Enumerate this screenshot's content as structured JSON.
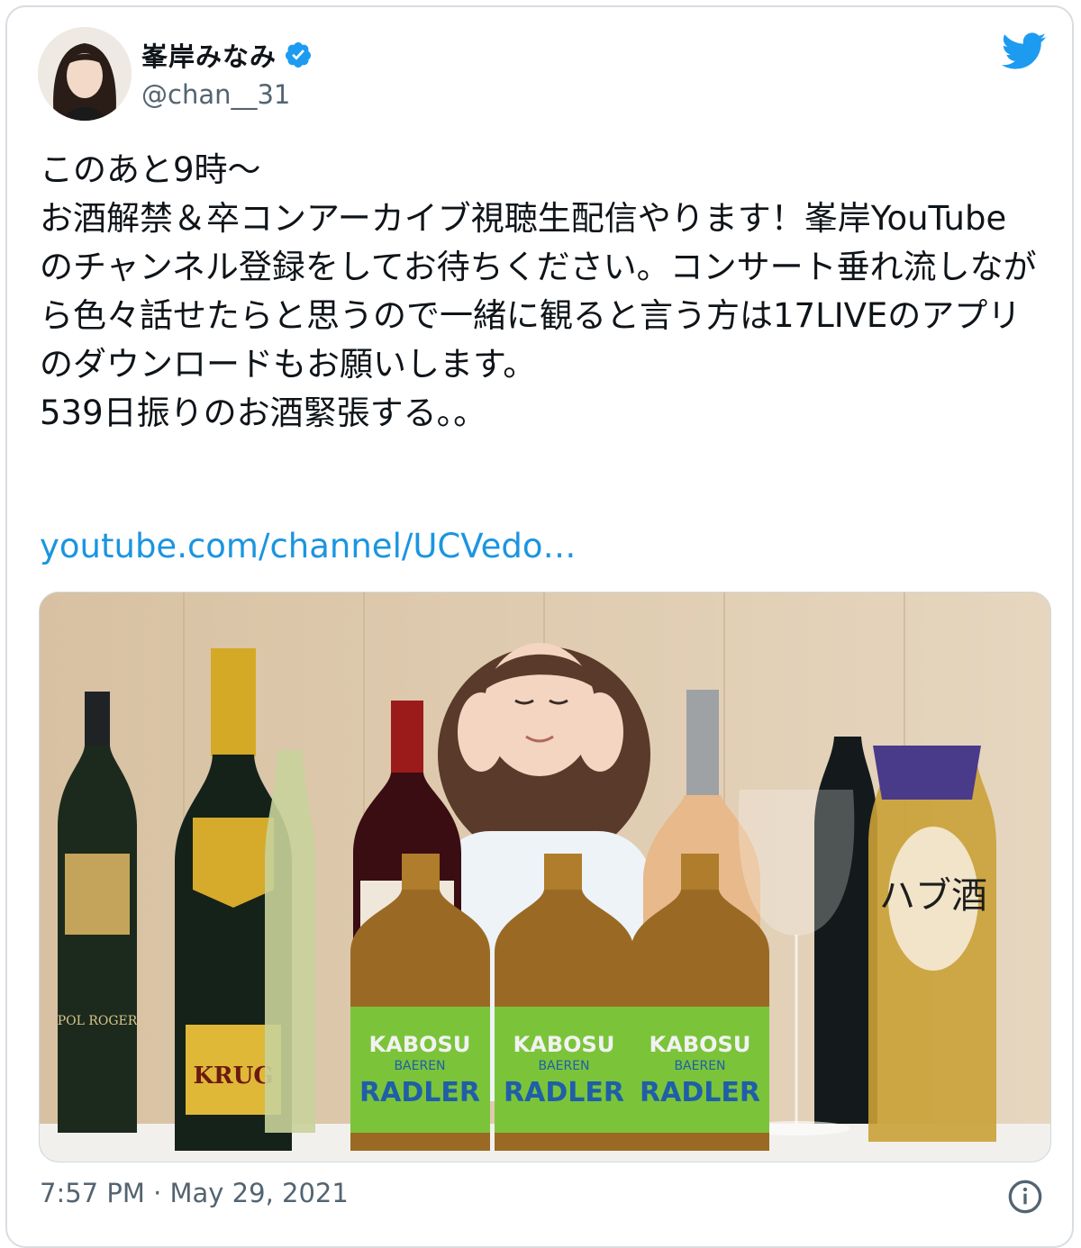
{
  "author": {
    "name": "峯岸みなみ",
    "handle": "@chan__31",
    "verified": true
  },
  "tweet": {
    "text": "このあと9時〜\nお酒解禁＆卒コンアーカイブ視聴生配信やります！峯岸YouTubeのチャンネル登録をしてお待ちください。コンサート垂れ流しながら色々話せたらと思うので一緒に観ると言う方は17LIVEのアプリのダウンロードもお願いします。\n539日振りのお酒緊張する。。",
    "link": "youtube.com/channel/UCVedo…",
    "timestamp": "7:57 PM · May 29, 2021"
  },
  "media": {
    "bottle_labels": [
      "POL ROGER",
      "KRUG",
      "KABOSU",
      "BAEREN",
      "RADLER",
      "ハブ酒"
    ]
  },
  "icons": {
    "brand": "twitter-bird-icon",
    "verified": "verified-badge-icon",
    "info": "info-icon"
  },
  "colors": {
    "accent": "#1d9bf0",
    "link": "#1b95e0",
    "text": "#0f1419",
    "secondary": "#536471"
  }
}
